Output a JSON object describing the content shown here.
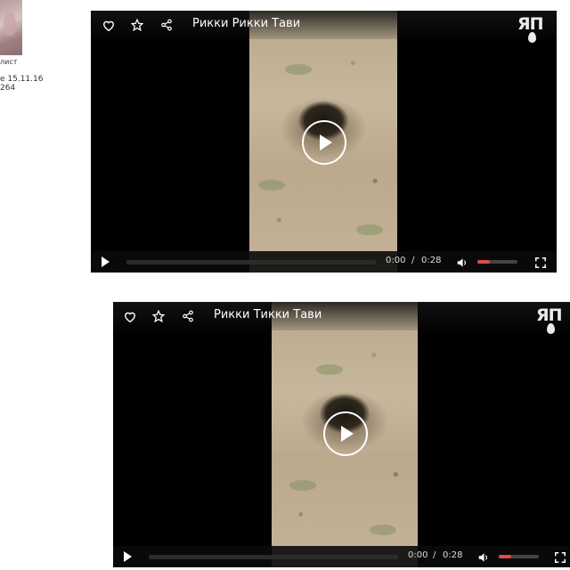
{
  "user": {
    "role": "лист",
    "date": "е 15.11.16",
    "count": "264"
  },
  "players": [
    {
      "title": "Рикки Рикки Тави",
      "logo": "ЯП",
      "current_time": "0:00",
      "separator": "/",
      "duration": "0:28",
      "volume_level": 0.3,
      "progress": 0,
      "icons": [
        "heart-icon",
        "star-icon",
        "share-icon",
        "play-icon",
        "volume-icon",
        "fullscreen-icon"
      ]
    },
    {
      "title": "Рикки Тикки Тави",
      "logo": "ЯП",
      "current_time": "0:00",
      "separator": "/",
      "duration": "0:28",
      "volume_level": 0.3,
      "progress": 0,
      "icons": [
        "heart-icon",
        "star-icon",
        "share-icon",
        "play-icon",
        "volume-icon",
        "fullscreen-icon"
      ]
    }
  ],
  "colors": {
    "accent": "#e04b4b",
    "player_bg": "#000000"
  }
}
